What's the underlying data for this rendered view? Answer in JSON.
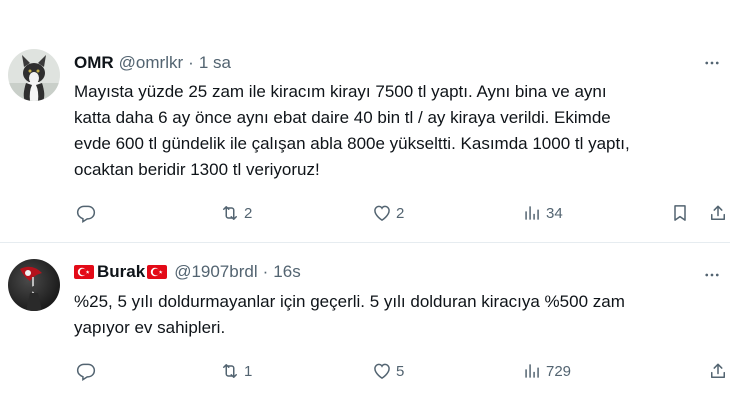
{
  "tweets": [
    {
      "name": "OMR",
      "handle": "@omrlkr",
      "dot": "·",
      "time": "1 sa",
      "text_lines": [
        "Mayısta yüzde 25 zam ile kiracım kirayı 7500 tl yaptı. Aynı bina ve aynı",
        "katta daha 6 ay önce aynı ebat daire 40 bin tl / ay kiraya verildi. Ekimde",
        "evde 600 tl gündelik ile çalışan abla 800e yükseltti. Kasımda 1000 tl yaptı,",
        "ocaktan beridir 1300 tl veriyoruz!"
      ],
      "stats": {
        "reply": "",
        "retweet": "2",
        "like": "2",
        "views": "34"
      },
      "icons": [
        "more-icon",
        "reply-icon",
        "retweet-icon",
        "like-icon",
        "views-icon",
        "bookmark-icon",
        "share-icon"
      ]
    },
    {
      "name": "Burak",
      "handle": "@1907brdl",
      "dot": "·",
      "time": "16s",
      "text_lines": [
        "%25, 5 yılı doldurmayanlar için geçerli. 5 yılı dolduran kiracıya %500 zam",
        "yapıyor ev sahipleri."
      ],
      "stats": {
        "reply": "",
        "retweet": "1",
        "like": "5",
        "views": "729"
      },
      "icons": [
        "turkish-flag-icon",
        "more-icon",
        "reply-icon",
        "retweet-icon",
        "like-icon",
        "views-icon",
        "share-icon"
      ]
    }
  ],
  "colors": {
    "text": "#0f1419",
    "muted": "#536471",
    "divider": "#e6ecf0",
    "flag_red": "#e30a17"
  }
}
